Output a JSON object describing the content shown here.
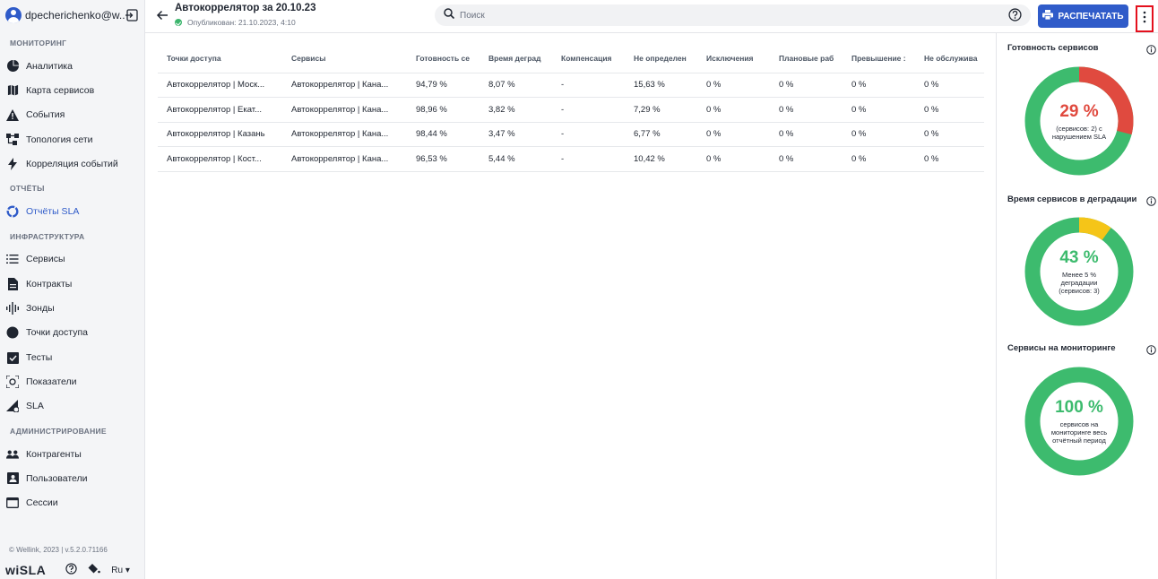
{
  "sidebar": {
    "user_name": "dpecherichenko@w...",
    "sections": [
      {
        "title": "МОНИТОРИНГ"
      },
      {
        "title": "ОТЧЁТЫ"
      },
      {
        "title": "ИНФРАСТРУКТУРА"
      },
      {
        "title": "АДМИНИСТРИРОВАНИЕ"
      }
    ],
    "items": [
      {
        "label": "Аналитика",
        "icon": "pie-chart-icon"
      },
      {
        "label": "Карта сервисов",
        "icon": "map-icon"
      },
      {
        "label": "События",
        "icon": "warning-icon"
      },
      {
        "label": "Топология сети",
        "icon": "topology-icon"
      },
      {
        "label": "Корреляция событий",
        "icon": "bolt-icon"
      },
      {
        "label": "Отчёты SLA",
        "icon": "sla-report-icon"
      },
      {
        "label": "Сервисы",
        "icon": "list-icon"
      },
      {
        "label": "Контракты",
        "icon": "document-icon"
      },
      {
        "label": "Зонды",
        "icon": "probe-icon"
      },
      {
        "label": "Точки доступа",
        "icon": "access-point-icon"
      },
      {
        "label": "Тесты",
        "icon": "test-icon"
      },
      {
        "label": "Показатели",
        "icon": "metrics-icon"
      },
      {
        "label": "SLA",
        "icon": "sla-icon"
      },
      {
        "label": "Контрагенты",
        "icon": "group-icon"
      },
      {
        "label": "Пользователи",
        "icon": "user-card-icon"
      },
      {
        "label": "Сессии",
        "icon": "sessions-icon"
      }
    ],
    "copyright": "© Wellink, 2023 | v.5.2.0.71166",
    "logo": "wiSLA",
    "language": "Ru"
  },
  "header": {
    "title": "Автокоррелятор за 20.10.23",
    "subtitle": "Опубликован: 21.10.2023, 4:10",
    "search_placeholder": "Поиск",
    "print_label": "РАСПЕЧАТАТЬ"
  },
  "table": {
    "columns": [
      "Точки доступа",
      "Сервисы",
      "Готовность се",
      "Время деград",
      "Компенсация",
      "Не определен",
      "Исключения",
      "Плановые раб",
      "Превышение :",
      "Не обслужива"
    ],
    "rows": [
      [
        "Автокоррелятор | Моск...",
        "Автокоррелятор | Кана...",
        "94,79 %",
        "8,07 %",
        "-",
        "15,63 %",
        "0 %",
        "0 %",
        "0 %",
        "0 %"
      ],
      [
        "Автокоррелятор | Екат...",
        "Автокоррелятор | Кана...",
        "98,96 %",
        "3,82 %",
        "-",
        "7,29 %",
        "0 %",
        "0 %",
        "0 %",
        "0 %"
      ],
      [
        "Автокоррелятор | Казань",
        "Автокоррелятор | Кана...",
        "98,44 %",
        "3,47 %",
        "-",
        "6,77 %",
        "0 %",
        "0 %",
        "0 %",
        "0 %"
      ],
      [
        "Автокоррелятор | Кост...",
        "Автокоррелятор | Кана...",
        "96,53 %",
        "5,44 %",
        "-",
        "10,42 %",
        "0 %",
        "0 %",
        "0 %",
        "0 %"
      ]
    ]
  },
  "widgets": [
    {
      "title": "Готовность сервисов",
      "value": "29 %",
      "caption": "(сервисов: 2) с нарушением SLA",
      "fraction": 0.29,
      "arc_color": "#e04a3f",
      "track_color": "#3dbb6e",
      "text_color": "#e04a3f"
    },
    {
      "title": "Время сервисов в деградации",
      "value": "43 %",
      "caption": "Менее 5 % деградации (сервисов: 3)",
      "fraction": 0.1,
      "arc_color": "#f5c518",
      "track_color": "#3dbb6e",
      "text_color": "#3dbb6e"
    },
    {
      "title": "Сервисы на мониторинге",
      "value": "100 %",
      "caption": "сервисов на мониторинге весь отчётный период",
      "fraction": 0.0,
      "arc_color": "#3dbb6e",
      "track_color": "#3dbb6e",
      "text_color": "#3dbb6e"
    }
  ],
  "colors": {
    "accent": "#2f5bc9",
    "ok": "#3dbb6e",
    "error": "#e04a3f",
    "warning": "#f5c518"
  }
}
